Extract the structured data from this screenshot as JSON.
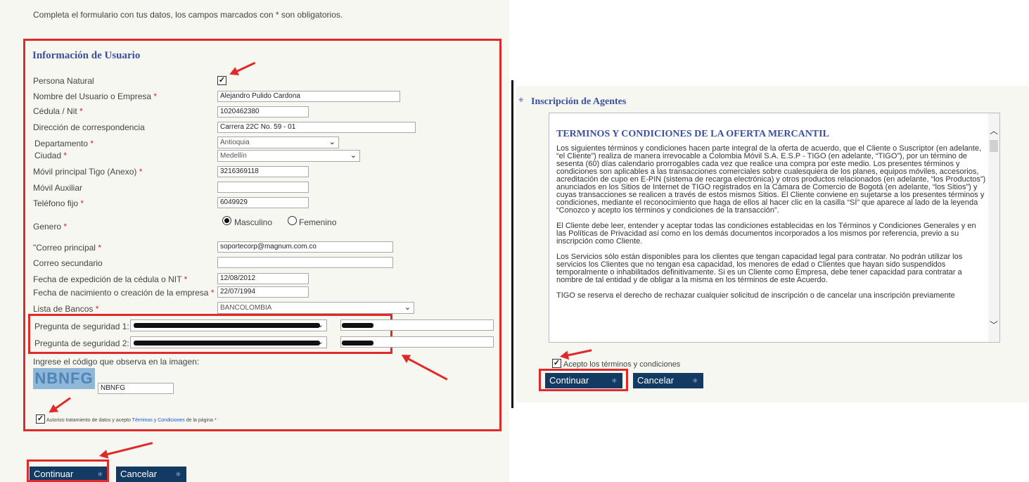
{
  "left": {
    "intro": "Completa el formulario con tus datos, los campos marcados con * son obligatorios.",
    "section_title": "Información de Usuario",
    "fields": {
      "persona_natural": {
        "label": "Persona Natural"
      },
      "nombre": {
        "label": "Nombre del Usuario o Empresa",
        "value": "Alejandro Pulido Cardona"
      },
      "cedula": {
        "label": "Cédula / Nit",
        "value": "1020462380"
      },
      "direccion": {
        "label": "Dirección de correspondencia",
        "value": "Carrera 22C No. 59 - 01"
      },
      "departamento": {
        "label": "Departamento",
        "value": "Antioquia"
      },
      "ciudad": {
        "label": "Ciudad",
        "value": "Medellín"
      },
      "movil": {
        "label": "Móvil principal Tigo (Anexo)",
        "value": "3216369118"
      },
      "movil_aux": {
        "label": "Móvil Auxiliar",
        "value": ""
      },
      "telefono": {
        "label": "Teléfono fijo",
        "value": "6049929"
      },
      "genero": {
        "label": "Genero",
        "option1": "Masculino",
        "option2": "Femenino"
      },
      "correo": {
        "label": "\"Correo principal",
        "value": "soportecorp@magnum.com.co"
      },
      "correo_sec": {
        "label": "Correo secundario",
        "value": ""
      },
      "fecha_exp": {
        "label": "Fecha de expedición de la cédula o NIT",
        "value": "12/08/2012"
      },
      "fecha_nac": {
        "label": "Fecha de nacimiento o creación de la empresa",
        "value": "22/07/1994"
      },
      "bancos": {
        "label": "Lista de Bancos",
        "value": "BANCOLOMBIA"
      },
      "pregunta1": {
        "label": "Pregunta de seguridad 1:"
      },
      "pregunta2": {
        "label": "Pregunta de seguridad 2:"
      },
      "captcha_label": "Ingrese el código que observa en la imagen:",
      "captcha_image": "NBNFG",
      "captcha_value": "NBNFG"
    },
    "autorizo": {
      "prefix": "Autorizo tratamiento de datos y acepto ",
      "link": "Términos y Condiciones",
      "suffix": " de la página"
    },
    "required_mark": "*",
    "buttons": {
      "continuar": "Continuar",
      "cancelar": "Cancelar"
    }
  },
  "right": {
    "title": "Inscripción de Agentes",
    "terms_title": "TERMINOS Y CONDICIONES DE LA OFERTA MERCANTIL",
    "paragraphs": [
      "Los siguientes términos y condiciones hacen parte integral de la oferta de acuerdo, que el Cliente o Suscriptor (en adelante, “el Cliente”) realiza de manera irrevocable a Colombia Móvil S.A. E.S.P - TIGO (en adelante, “TIGO”), por un término de sesenta (60) días calendario prorrogables cada vez que realice una compra por este medio. Los presentes términos y condiciones son aplicables a las transacciones comerciales sobre cualesquiera de los planes, equipos móviles, accesorios, acreditación de cupo en E-PIN (sistema de recarga electrónica) y otros productos relacionados (en adelante, “los Productos”) anunciados en los Sitios de Internet de TIGO registrados en la Cámara de Comercio de Bogotá (en adelante, “los Sitios”) y cuyas transacciones se realicen a través de estos mismos Sitios. El Cliente conviene en sujetarse a los presentes términos y condiciones, mediante el reconocimiento que haga de ellos al hacer clic en la casilla “SÍ” que aparece al lado de la leyenda “Conozco y acepto los términos y condiciones de la transacción”.",
      "El Cliente debe leer, entender y aceptar todas las condiciones establecidas en los Términos y Condiciones Generales y en las Políticas de Privacidad así como en los demás documentos incorporados a los mismos por referencia, previo a su inscripción como Cliente.",
      "Los Servicios sólo están disponibles para los clientes que tengan capacidad legal para contratar. No podrán utilizar los servicios los Clientes que no tengan esa capacidad, los menores de edad o Clientes que hayan sido suspendidos temporalmente o inhabilitados definitivamente. Si es un Cliente como Empresa, debe tener capacidad para contratar a nombre de tal entidad y de obligar a la misma en los términos de este Acuerdo.",
      "TIGO se reserva el derecho de rechazar cualquier solicitud de inscripción o de cancelar una inscripción previamente"
    ],
    "acepto": "Acepto los términos y condiciones",
    "buttons": {
      "continuar": "Continuar",
      "cancelar": "Cancelar"
    }
  }
}
